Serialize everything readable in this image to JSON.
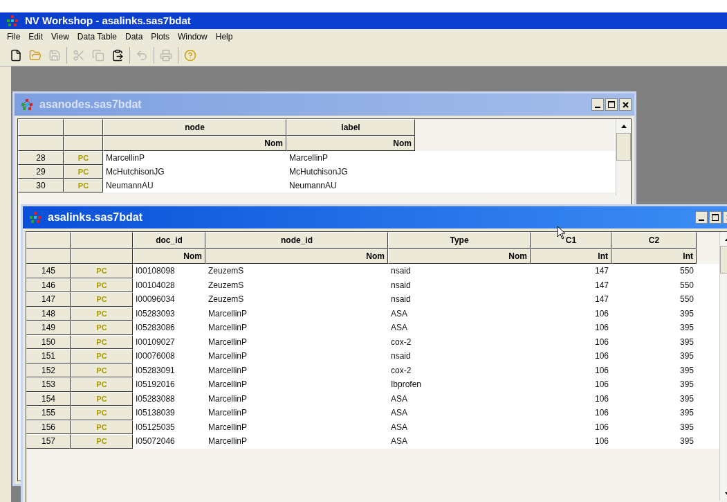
{
  "app": {
    "title": "NV Workshop - asalinks.sas7bdat"
  },
  "menu": [
    "File",
    "Edit",
    "View",
    "Data Table",
    "Data",
    "Plots",
    "Window",
    "Help"
  ],
  "toolbar": [
    {
      "kind": "new",
      "disabled": false
    },
    {
      "kind": "open",
      "disabled": false
    },
    {
      "kind": "save",
      "disabled": true
    },
    {
      "kind": "separator"
    },
    {
      "kind": "cut",
      "disabled": true
    },
    {
      "kind": "copy",
      "disabled": true
    },
    {
      "kind": "paste",
      "disabled": false
    },
    {
      "kind": "separator"
    },
    {
      "kind": "undo",
      "disabled": true
    },
    {
      "kind": "separator"
    },
    {
      "kind": "print",
      "disabled": true
    },
    {
      "kind": "separator"
    },
    {
      "kind": "help",
      "disabled": false
    }
  ],
  "windows": [
    {
      "title": "asanodes.sas7bdat",
      "active": false,
      "columns": [
        {
          "name": "node",
          "type": "Nom"
        },
        {
          "name": "label",
          "type": "Nom"
        }
      ],
      "rows": [
        {
          "number": "28",
          "flag": "PC",
          "cells": [
            "MarcellinP",
            "MarcellinP"
          ]
        },
        {
          "number": "29",
          "flag": "PC",
          "cells": [
            "McHutchisonJG",
            "McHutchisonJG"
          ]
        },
        {
          "number": "30",
          "flag": "PC",
          "cells": [
            "NeumannAU",
            "NeumannAU"
          ]
        }
      ]
    },
    {
      "title": "asalinks.sas7bdat",
      "active": true,
      "columns": [
        {
          "name": "doc_id",
          "type": "Nom"
        },
        {
          "name": "node_id",
          "type": "Nom"
        },
        {
          "name": "Type",
          "type": "Nom"
        },
        {
          "name": "C1",
          "type": "Int"
        },
        {
          "name": "C2",
          "type": "Int"
        }
      ],
      "rows": [
        {
          "number": "145",
          "flag": "PC",
          "cells": [
            "I00108098",
            "ZeuzemS",
            "nsaid",
            "147",
            "550"
          ]
        },
        {
          "number": "146",
          "flag": "PC",
          "cells": [
            "I00104028",
            "ZeuzemS",
            "nsaid",
            "147",
            "550"
          ]
        },
        {
          "number": "147",
          "flag": "PC",
          "cells": [
            "I00096034",
            "ZeuzemS",
            "nsaid",
            "147",
            "550"
          ]
        },
        {
          "number": "148",
          "flag": "PC",
          "cells": [
            "I05283093",
            "MarcellinP",
            "ASA",
            "106",
            "395"
          ]
        },
        {
          "number": "149",
          "flag": "PC",
          "cells": [
            "I05283086",
            "MarcellinP",
            "ASA",
            "106",
            "395"
          ]
        },
        {
          "number": "150",
          "flag": "PC",
          "cells": [
            "I00109027",
            "MarcellinP",
            "cox-2",
            "106",
            "395"
          ]
        },
        {
          "number": "151",
          "flag": "PC",
          "cells": [
            "I00076008",
            "MarcellinP",
            "nsaid",
            "106",
            "395"
          ]
        },
        {
          "number": "152",
          "flag": "PC",
          "cells": [
            "I05283091",
            "MarcellinP",
            "cox-2",
            "106",
            "395"
          ]
        },
        {
          "number": "153",
          "flag": "PC",
          "cells": [
            "I05192016",
            "MarcellinP",
            "Ibprofen",
            "106",
            "395"
          ]
        },
        {
          "number": "154",
          "flag": "PC",
          "cells": [
            "I05283088",
            "MarcellinP",
            "ASA",
            "106",
            "395"
          ]
        },
        {
          "number": "155",
          "flag": "PC",
          "cells": [
            "I05138039",
            "MarcellinP",
            "ASA",
            "106",
            "395"
          ]
        },
        {
          "number": "156",
          "flag": "PC",
          "cells": [
            "I05125035",
            "MarcellinP",
            "ASA",
            "106",
            "395"
          ]
        },
        {
          "number": "157",
          "flag": "PC",
          "cells": [
            "I05072046",
            "MarcellinP",
            "ASA",
            "106",
            "395"
          ]
        }
      ]
    }
  ]
}
